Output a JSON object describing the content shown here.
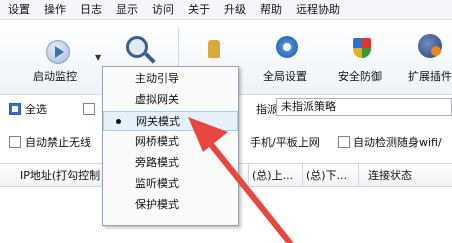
{
  "menubar": {
    "items": [
      "设置",
      "操作",
      "日志",
      "显示",
      "访问",
      "关于",
      "升级",
      "帮助",
      "远程协助"
    ]
  },
  "toolbar": {
    "start_monitor": "启动监控",
    "global_settings": "全局设置",
    "security_defense": "安全防御",
    "extensions": "扩展插件"
  },
  "options": {
    "select_all": "全选",
    "assign_label": "指派",
    "policy_value": "未指派策略",
    "auto_block_wireless": "自动禁止无线",
    "phone_tablet": "手机/平板上网",
    "auto_detect_wifi": "自动检测随身wifi/"
  },
  "table": {
    "col_ip": "IP地址(打勾控制",
    "col_total_up": "(总)上...",
    "col_total_down": "(总)下...",
    "col_status": "连接状态"
  },
  "dropdown": {
    "items": [
      "主动引导",
      "虚拟网关",
      "网关模式",
      "网桥模式",
      "旁路模式",
      "监听模式",
      "保护模式"
    ],
    "selected": "网关模式"
  },
  "colors": {
    "arrow": "#e8473f",
    "highlight": "#e5f0fb",
    "accent": "#2f6fcf"
  }
}
